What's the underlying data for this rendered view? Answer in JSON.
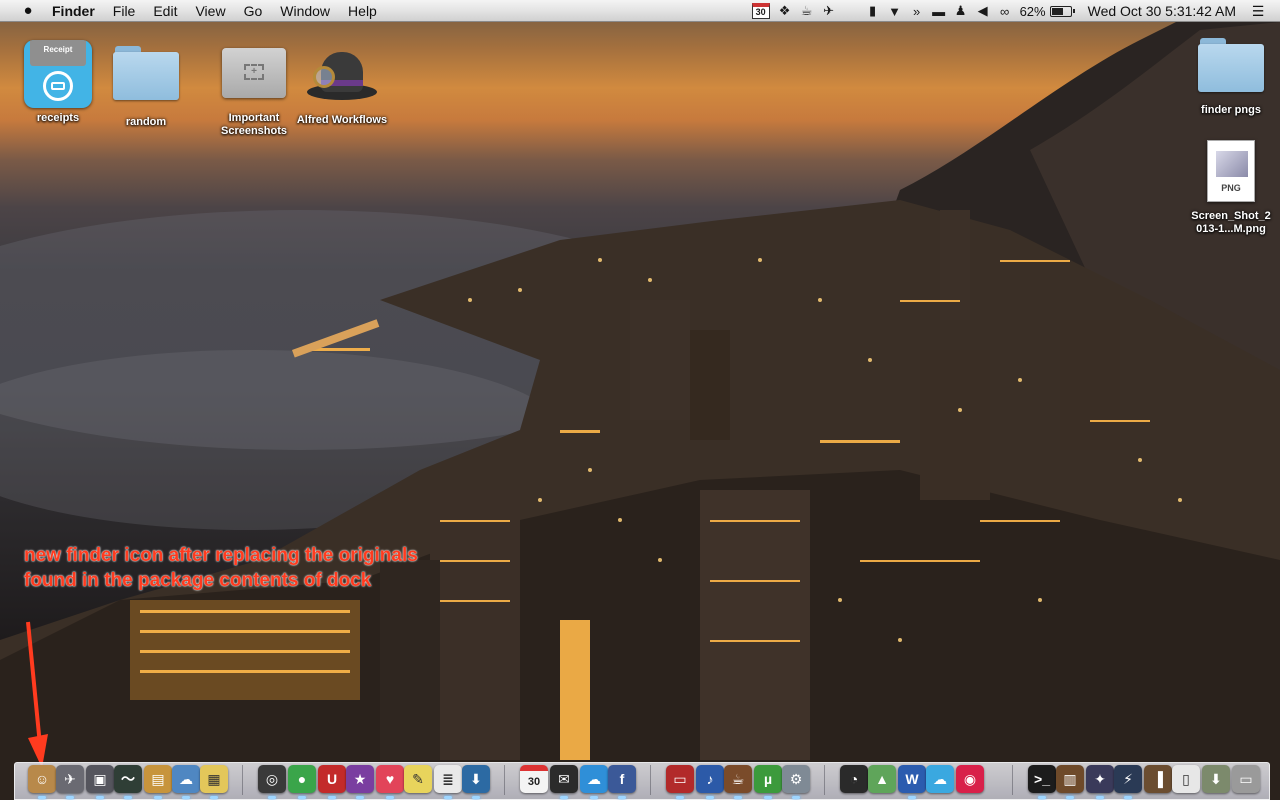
{
  "menubar": {
    "apple_menu": "",
    "app_name": "Finder",
    "menus": [
      "File",
      "Edit",
      "View",
      "Go",
      "Window",
      "Help"
    ],
    "calendar_day": "30",
    "battery_percent": "62%",
    "battery_level": 0.62,
    "clock": "Wed Oct 30   5:31:42 AM"
  },
  "desktop": {
    "icons": [
      {
        "label": "receipts",
        "receipt_text": "Receipt"
      },
      {
        "label": "random"
      },
      {
        "label": "Important Screenshots"
      },
      {
        "label": "Alfred Workflows"
      },
      {
        "label": "finder pngs"
      },
      {
        "label": "Screen_Shot_2013-1...M.png",
        "kind": "PNG"
      }
    ]
  },
  "annotation": {
    "line1": "new finder icon after replacing the originals",
    "line2": "found in the package contents of dock",
    "color": "#ff3b1f"
  },
  "dock": {
    "calendar_day": "30",
    "items": [
      {
        "icon": "finder-icon",
        "glyph": "☺",
        "color": "#b8894a"
      },
      {
        "icon": "launchpad-icon",
        "glyph": "✈",
        "color": "#6a6a72"
      },
      {
        "icon": "photo-icon",
        "glyph": "▣",
        "color": "#55555d"
      },
      {
        "icon": "activity-monitor-icon",
        "glyph": "〜",
        "color": "#2f3e36"
      },
      {
        "icon": "archive-icon",
        "glyph": "▤",
        "color": "#c7943c"
      },
      {
        "icon": "weather-icon",
        "glyph": "☁",
        "color": "#4f87c2"
      },
      {
        "icon": "preview-icon",
        "glyph": "▦",
        "color": "#e3c75a"
      },
      {
        "icon": "safari-icon",
        "glyph": "◎",
        "color": "#3a3a3a"
      },
      {
        "icon": "messages-icon",
        "glyph": "●",
        "color": "#3aa54a"
      },
      {
        "icon": "texteditor-icon",
        "glyph": "U",
        "color": "#c32a2a"
      },
      {
        "icon": "reeder-icon",
        "glyph": "★",
        "color": "#7a3ea0"
      },
      {
        "icon": "pocket-icon",
        "glyph": "♥",
        "color": "#e24459"
      },
      {
        "icon": "stickies-icon",
        "glyph": "✎",
        "color": "#e8d45c"
      },
      {
        "icon": "notes-icon",
        "glyph": "≣",
        "color": "#e9e9e9"
      },
      {
        "icon": "save-icon",
        "glyph": "⬇",
        "color": "#2c6aa3"
      },
      {
        "icon": "calendar-icon",
        "glyph": "30",
        "color": "#f4f4f4"
      },
      {
        "icon": "mail-icon",
        "glyph": "✉",
        "color": "#2b2b2b"
      },
      {
        "icon": "twitterrific-icon",
        "glyph": "☁",
        "color": "#2f8fd8"
      },
      {
        "icon": "facebook-icon",
        "glyph": "f",
        "color": "#3b5998"
      },
      {
        "icon": "photobooth-icon",
        "glyph": "▭",
        "color": "#b22a2a"
      },
      {
        "icon": "itunes-icon",
        "glyph": "♪",
        "color": "#2c5aa8"
      },
      {
        "icon": "coffee-icon",
        "glyph": "☕",
        "color": "#7a4b2a"
      },
      {
        "icon": "utorrent-icon",
        "glyph": "µ",
        "color": "#3c9a3c"
      },
      {
        "icon": "preferences-icon",
        "glyph": "⚙",
        "color": "#7f8a95"
      },
      {
        "icon": "dashboard-icon",
        "glyph": "◔",
        "color": "#2a2a2a"
      },
      {
        "icon": "maps-icon",
        "glyph": "▲",
        "color": "#5fa55a"
      },
      {
        "icon": "word-icon",
        "glyph": "W",
        "color": "#2b5caf"
      },
      {
        "icon": "cloud-icon",
        "glyph": "☁",
        "color": "#3aa8e0"
      },
      {
        "icon": "lips-icon",
        "glyph": "◉",
        "color": "#d8204a"
      },
      {
        "icon": "terminal-icon",
        "glyph": ">_",
        "color": "#1c1c1c"
      },
      {
        "icon": "briefcase-icon",
        "glyph": "▥",
        "color": "#6e4a2a"
      },
      {
        "icon": "imovie-icon",
        "glyph": "✦",
        "color": "#3a3a5a"
      },
      {
        "icon": "spark-icon",
        "glyph": "⚡",
        "color": "#2a3a55"
      },
      {
        "icon": "books-icon",
        "glyph": "▐",
        "color": "#6b4d30"
      },
      {
        "icon": "document-icon",
        "glyph": "▯",
        "color": "#e7e7e7"
      },
      {
        "icon": "downloads-icon",
        "glyph": "⬇",
        "color": "#7c8a6c"
      },
      {
        "icon": "trash-icon",
        "glyph": "▭",
        "color": "#9a9a9a"
      }
    ]
  }
}
